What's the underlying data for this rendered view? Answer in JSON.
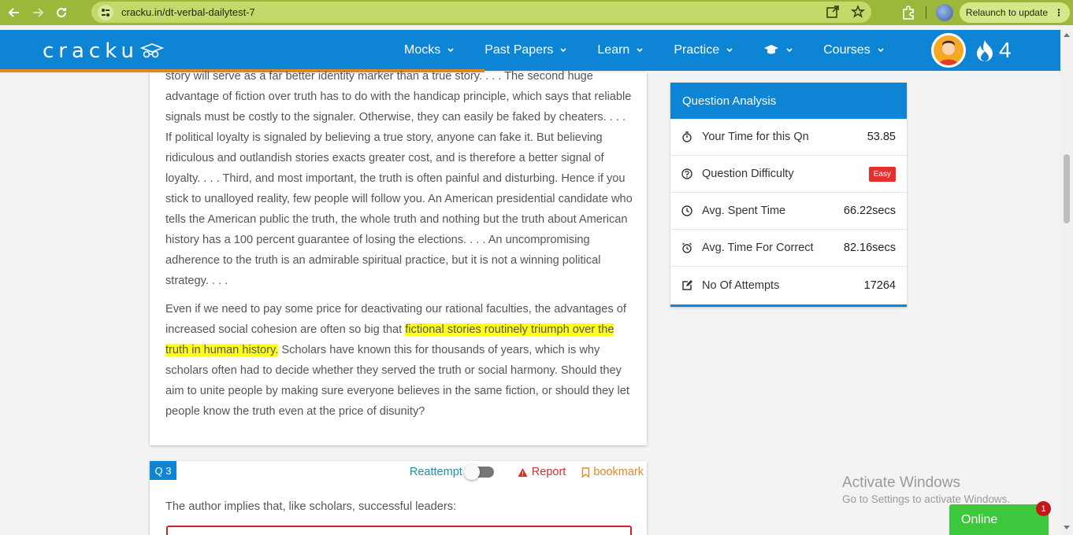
{
  "browser": {
    "url": "cracku.in/dt-verbal-dailytest-7",
    "relaunch_label": "Relaunch to update",
    "icons": [
      "back-icon",
      "forward-icon",
      "reload-icon",
      "site-info-icon",
      "open-external-icon",
      "star-icon",
      "extensions-icon",
      "profile-icon",
      "more-vert-icon"
    ]
  },
  "header": {
    "logo": "cracku",
    "menu": [
      {
        "label": "Mocks"
      },
      {
        "label": "Past Papers"
      },
      {
        "label": "Learn"
      },
      {
        "label": "Practice"
      },
      {
        "label": ""
      },
      {
        "label": "Courses"
      }
    ],
    "streak": "4"
  },
  "passage": {
    "p1": "story will serve as a far better identity marker than a true story. . . . The second huge advantage of fiction over truth has to do with the handicap principle, which says that reliable signals must be costly to the signaler. Otherwise, they can easily be faked by cheaters. . . . If political loyalty is signaled by believing a true story, anyone can fake it. But believing ridiculous and outlandish stories exacts greater cost, and is therefore a better signal of loyalty. . . . Third, and most important, the truth is often painful and disturbing. Hence if you stick to unalloyed reality, few people will follow you. An American presidential candidate who tells the American public the truth, the whole truth and nothing but the truth about American history has a 100 percent guarantee of losing the elections. . . . An uncompromising adherence to the truth is an admirable spiritual practice, but it is not a winning political strategy. . . .",
    "p2_before": "Even if we need to pay some price for deactivating our rational faculties, the advantages of increased social cohesion are often so big that ",
    "p2_highlight": "fictional stories routinely triumph over the truth in human history.",
    "p2_after": " Scholars have known this for thousands of years, which is why scholars often had to decide whether they served the truth or social harmony. Should they aim to unite people by making sure everyone believes in the same fiction, or should they let people know the truth even at the price of disunity?"
  },
  "analysis": {
    "title": "Question Analysis",
    "rows": [
      {
        "label": "Your Time for this Qn",
        "value": "53.85"
      },
      {
        "label": "Question Difficulty",
        "value": "Easy"
      },
      {
        "label": "Avg. Spent Time",
        "value": "66.22secs"
      },
      {
        "label": "Avg. Time For Correct",
        "value": "82.16secs"
      },
      {
        "label": "No Of Attempts",
        "value": "17264"
      }
    ]
  },
  "question": {
    "number": "Q 3",
    "reattempt_label": "Reattempt",
    "report_label": "Report",
    "bookmark_label": "bookmark",
    "text": "The author implies that, like scholars, successful leaders:"
  },
  "windows_notice": {
    "title": "Activate Windows",
    "subtitle": "Go to Settings to activate Windows."
  },
  "chat": {
    "label": "Online",
    "badge": "1"
  },
  "colors": {
    "brand": "#0e84d4",
    "accent": "#e8871e",
    "highlight": "#ffff1a",
    "browser_bar": "#9cb83a",
    "online": "#3ec83e"
  }
}
